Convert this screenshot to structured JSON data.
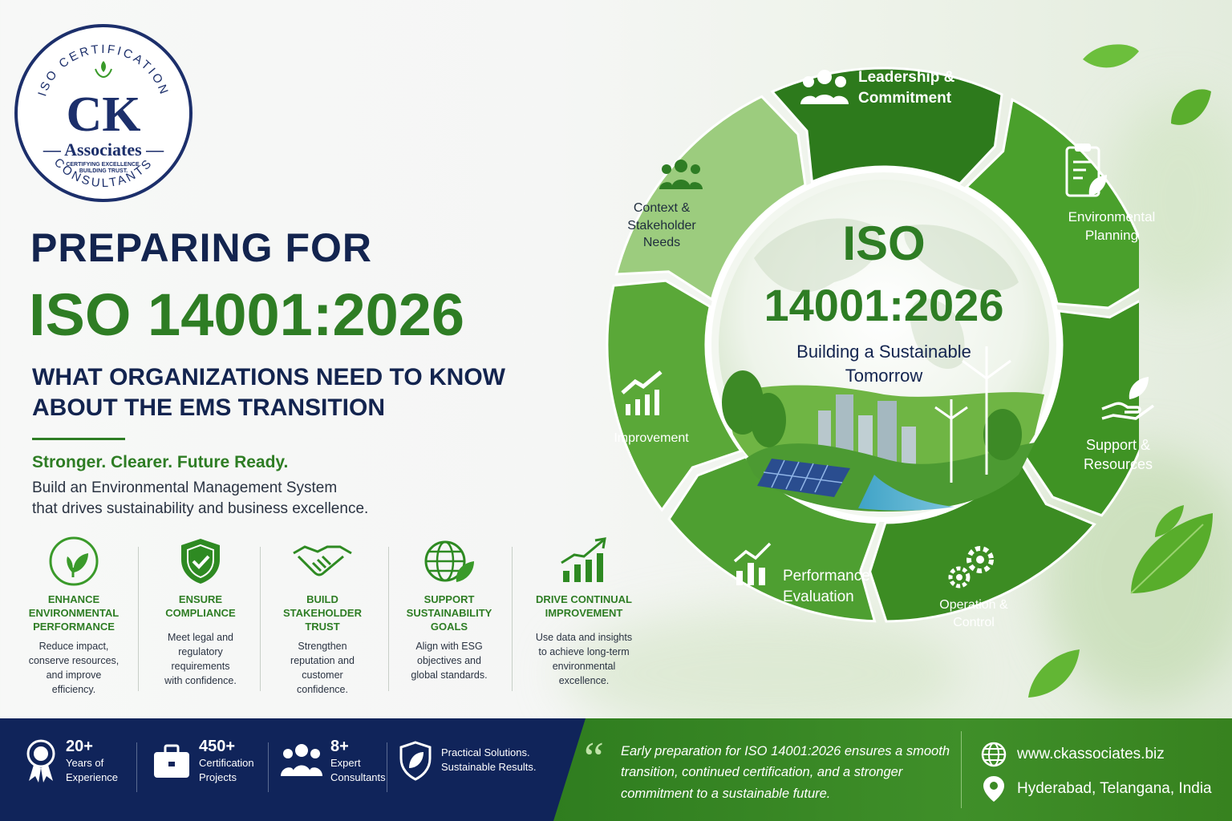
{
  "logo": {
    "arc_top": "ISO CERTIFICATION",
    "arc_bottom": "CONSULTANTS",
    "initials": "CK",
    "name": "Associates",
    "tagline_line1": "CERTIFYING EXCELLENCE.",
    "tagline_line2": "BUILDING TRUST."
  },
  "hero": {
    "line1": "PREPARING FOR",
    "line2": "ISO 14001:2026",
    "line3a": "WHAT ORGANIZATIONS NEED TO KNOW",
    "line3b": "ABOUT THE EMS TRANSITION",
    "tagline": "Stronger. Clearer. Future Ready.",
    "desc_line1": "Build an Environmental Management System",
    "desc_line2": "that drives sustainability and business excellence."
  },
  "benefits": [
    {
      "icon": "leaf-circle-icon",
      "title_lines": [
        "ENHANCE",
        "ENVIRONMENTAL",
        "PERFORMANCE"
      ],
      "desc_lines": [
        "Reduce impact,",
        "conserve resources,",
        "and improve",
        "efficiency."
      ]
    },
    {
      "icon": "shield-check-icon",
      "title_lines": [
        "ENSURE",
        "COMPLIANCE"
      ],
      "desc_lines": [
        "Meet legal and",
        "regulatory",
        "requirements",
        "with confidence."
      ]
    },
    {
      "icon": "handshake-icon",
      "title_lines": [
        "BUILD",
        "STAKEHOLDER",
        "TRUST"
      ],
      "desc_lines": [
        "Strengthen",
        "reputation and",
        "customer",
        "confidence."
      ]
    },
    {
      "icon": "globe-leaf-icon",
      "title_lines": [
        "SUPPORT",
        "SUSTAINABILITY",
        "GOALS"
      ],
      "desc_lines": [
        "Align with ESG",
        "objectives and",
        "global standards."
      ]
    },
    {
      "icon": "growth-chart-icon",
      "title_lines": [
        "DRIVE CONTINUAL",
        "IMPROVEMENT"
      ],
      "desc_lines": [
        "Use data and insights",
        "to achieve long-term",
        "environmental",
        "excellence."
      ]
    }
  ],
  "wheel": {
    "center_title_1": "ISO",
    "center_title_2": "14001:2026",
    "center_sub_1": "Building a Sustainable",
    "center_sub_2": "Tomorrow",
    "segments": [
      {
        "icon": "people-icon",
        "label_1": "Leadership &",
        "label_2": "Commitment"
      },
      {
        "icon": "clipboard-leaf-icon",
        "label_1": "Environmental",
        "label_2": "Planning"
      },
      {
        "icon": "hand-leaf-icon",
        "label_1": "Support &",
        "label_2": "Resources"
      },
      {
        "icon": "gears-icon",
        "label_1": "Operation &",
        "label_2": "Control"
      },
      {
        "icon": "performance-chart-icon",
        "label_1": "Performance",
        "label_2": "Evaluation"
      },
      {
        "icon": "improvement-chart-icon",
        "label_1": "Improvement",
        "label_2": ""
      },
      {
        "icon": "stakeholders-icon",
        "label_1": "Context &",
        "label_2": "Stakeholder",
        "label_3": "Needs"
      }
    ],
    "colors": [
      "#2d7a1c",
      "#4aa02c",
      "#3f9324",
      "#3c8c23",
      "#4e9f31",
      "#5aa838",
      "#9ccc7e"
    ]
  },
  "footer": {
    "stats": [
      {
        "icon": "award-ribbon-icon",
        "num": "20+",
        "line1": "Years of",
        "line2": "Experience"
      },
      {
        "icon": "briefcase-icon",
        "num": "450+",
        "line1": "Certification",
        "line2": "Projects"
      },
      {
        "icon": "team-icon",
        "num": "8+",
        "line1": "Expert",
        "line2": "Consultants"
      },
      {
        "icon": "shield-leaf-icon",
        "num": "",
        "line1": "Practical Solutions.",
        "line2": "Sustainable Results."
      }
    ],
    "quote_mark": "“",
    "quote_1": "Early preparation for ISO 14001:2026 ensures a smooth",
    "quote_2": "transition, continued certification, and a stronger",
    "quote_3": "commitment to a sustainable future.",
    "website": "www.ckassociates.biz",
    "location": "Hyderabad, Telangana, India"
  }
}
